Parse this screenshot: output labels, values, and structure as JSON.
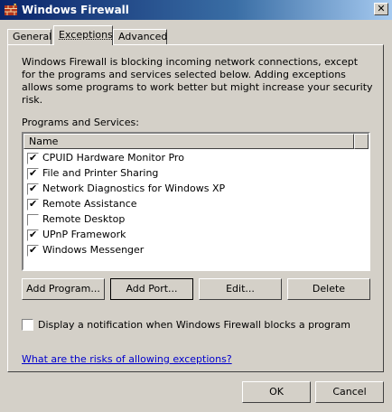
{
  "window": {
    "title": "Windows Firewall",
    "close_symbol": "✕"
  },
  "tabs": [
    {
      "label": "General"
    },
    {
      "label": "Exceptions",
      "active": true
    },
    {
      "label": "Advanced"
    }
  ],
  "exceptions": {
    "description": "Windows Firewall is blocking incoming network connections, except for the programs and services selected below. Adding exceptions allows some programs to work better but might increase your security risk.",
    "list_label": "Programs and Services:",
    "column_name": "Name",
    "items": [
      {
        "label": "CPUID Hardware Monitor Pro",
        "checked": true
      },
      {
        "label": "File and Printer Sharing",
        "checked": true
      },
      {
        "label": "Network Diagnostics for Windows XP",
        "checked": true
      },
      {
        "label": "Remote Assistance",
        "checked": true
      },
      {
        "label": "Remote Desktop",
        "checked": false
      },
      {
        "label": "UPnP Framework",
        "checked": true
      },
      {
        "label": "Windows Messenger",
        "checked": true
      }
    ],
    "buttons": {
      "add_program": "Add Program...",
      "add_port": "Add Port...",
      "edit": "Edit...",
      "delete": "Delete"
    },
    "notify_label": "Display a notification when Windows Firewall blocks a program",
    "notify_checked": false,
    "help_link": "What are the risks of allowing exceptions?"
  },
  "footer": {
    "ok": "OK",
    "cancel": "Cancel"
  },
  "icons": {
    "app": "firewall-icon",
    "checkmark": "✔"
  }
}
